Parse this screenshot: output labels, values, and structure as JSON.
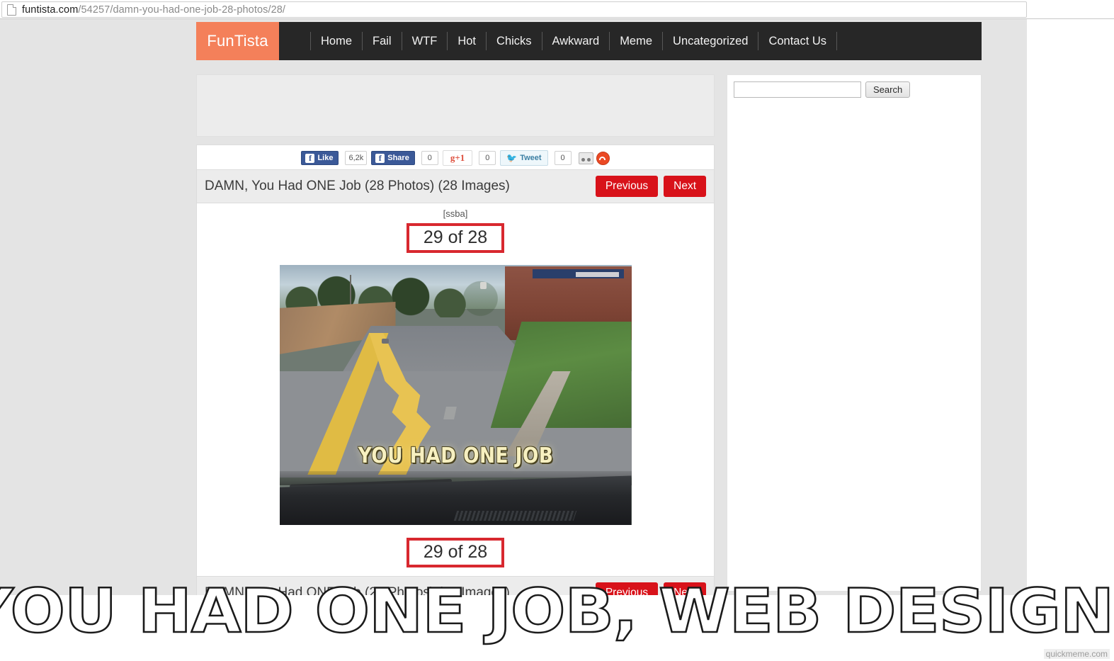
{
  "browser": {
    "url_domain": "funtista.com",
    "url_path": "/54257/damn-you-had-one-job-28-photos/28/",
    "page_icon": "document-icon"
  },
  "site": {
    "logo": "FunTista",
    "nav": [
      {
        "label": "Home"
      },
      {
        "label": "Fail"
      },
      {
        "label": "WTF"
      },
      {
        "label": "Hot"
      },
      {
        "label": "Chicks"
      },
      {
        "label": "Awkward"
      },
      {
        "label": "Meme"
      },
      {
        "label": "Uncategorized"
      },
      {
        "label": "Contact Us"
      }
    ],
    "colors": {
      "logo_bg": "#f4805a",
      "nav_bg": "#272727",
      "button_red": "#d8121a",
      "counter_border": "#d8282f"
    }
  },
  "social": {
    "fb_like_label": "Like",
    "fb_like_count": "6,2k",
    "fb_share_label": "Share",
    "fb_share_count": "0",
    "gplus_label": "+1",
    "gplus_count": "0",
    "tweet_label": "Tweet",
    "tweet_count": "0",
    "extra_icons": [
      "share-more-icon",
      "stumbleupon-icon"
    ]
  },
  "post": {
    "title": "DAMN, You Had ONE Job (28 Photos) (28 Images)",
    "prev_label": "Previous",
    "next_label": "Next",
    "shortcode": "[ssba]",
    "counter_top": "29 of 28",
    "counter_bottom": "29 of 28",
    "image_caption": "YOU HAD ONE JOB",
    "image_alt": "Road with a crooked wavy yellow center line seen through a car windshield"
  },
  "sidebar": {
    "search_value": "",
    "search_placeholder": "",
    "search_button": "Search"
  },
  "meme": {
    "caption": "YOU HAD ONE JOB, WEB DESIGNER!",
    "watermark": "quickmeme.com"
  }
}
